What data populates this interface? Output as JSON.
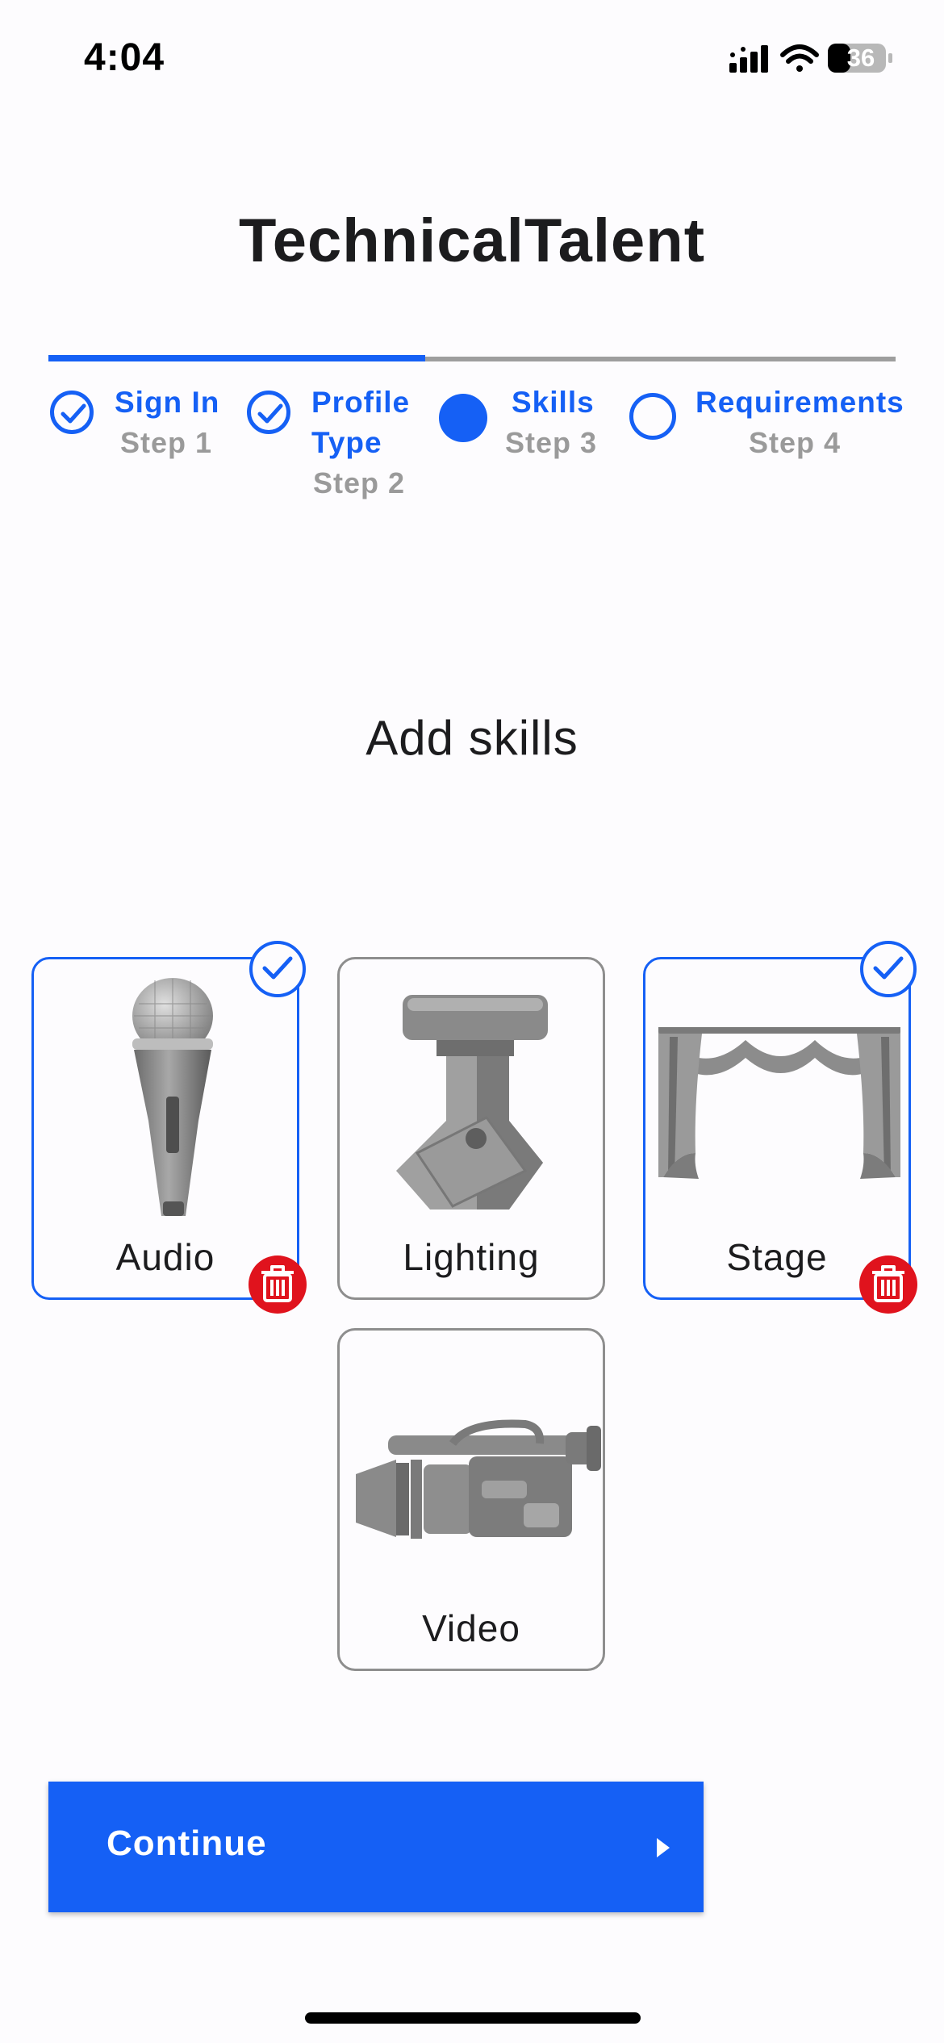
{
  "status_bar": {
    "time": "4:04",
    "battery": "36",
    "icons": [
      "cellular-signal-icon",
      "wifi-icon",
      "battery-icon"
    ]
  },
  "app": {
    "title": "TechnicalTalent"
  },
  "stepper": {
    "progress_fraction": 0.445,
    "steps": [
      {
        "label": "Sign In",
        "sub": "Step 1",
        "state": "completed"
      },
      {
        "label": "Profile Type",
        "label_line1": "Profile",
        "label_line2": "Type",
        "sub": "Step 2",
        "state": "completed"
      },
      {
        "label": "Skills",
        "sub": "Step 3",
        "state": "active"
      },
      {
        "label": "Requirements",
        "sub": "Step 4",
        "state": "pending"
      }
    ]
  },
  "main": {
    "heading": "Add skills",
    "skills": [
      {
        "label": "Audio",
        "selected": true,
        "icon": "microphone-icon"
      },
      {
        "label": "Lighting",
        "selected": false,
        "icon": "stage-light-icon"
      },
      {
        "label": "Stage",
        "selected": true,
        "icon": "stage-curtain-icon"
      },
      {
        "label": "Video",
        "selected": false,
        "icon": "video-camera-icon"
      }
    ]
  },
  "footer": {
    "continue_label": "Continue"
  },
  "colors": {
    "accent": "#1560f5",
    "delete": "#e0131d",
    "muted": "#9a9a9a",
    "card_border": "#8e8e8e"
  }
}
